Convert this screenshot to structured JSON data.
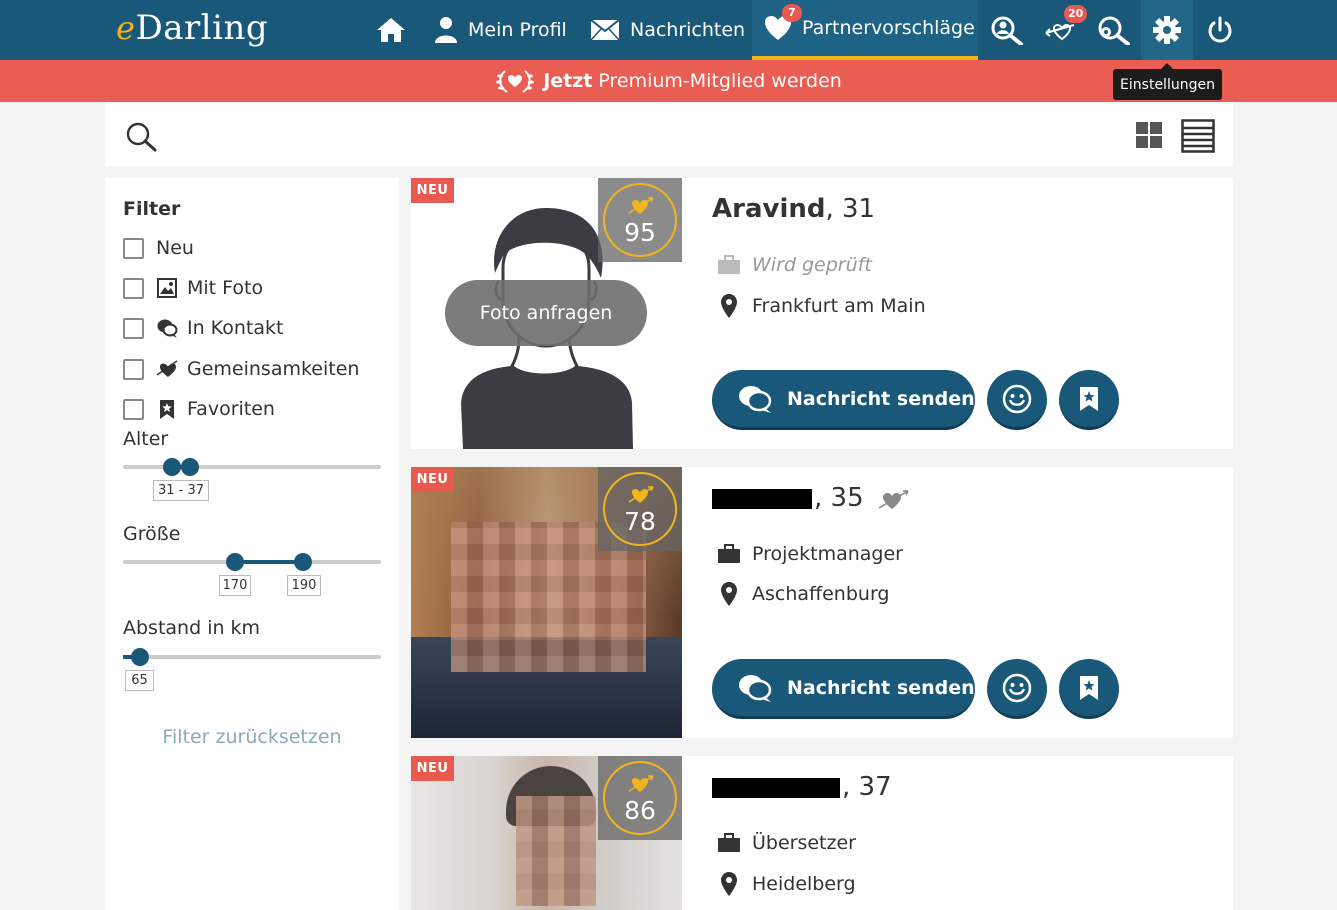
{
  "app": {
    "logo_prefix": "e",
    "logo_main": "Darling"
  },
  "nav": {
    "home_icon": "home-icon",
    "profile_label": "Mein Profil",
    "messages_label": "Nachrichten",
    "matches_label": "Partnervorschläge",
    "matches_badge": "7",
    "visitors_icon": "search-person-icon",
    "smiles_icon": "arrow-heart-icon",
    "smiles_badge": "20",
    "search_icon": "gear-search-icon",
    "settings_icon": "gear-icon",
    "logout_icon": "power-icon",
    "settings_tooltip": "Einstellungen"
  },
  "promo": {
    "bold": "Jetzt",
    "text": "Premium-Mitglied werden"
  },
  "colors": {
    "navy": "#1a5879",
    "coral": "#ea5d52",
    "gold": "#f2b51e"
  },
  "filter": {
    "title": "Filter",
    "options": [
      {
        "label": "Neu"
      },
      {
        "label": "Mit Foto"
      },
      {
        "label": "In Kontakt"
      },
      {
        "label": "Gemeinsamkeiten"
      },
      {
        "label": "Favoriten"
      }
    ],
    "age_label": "Alter",
    "age_value": "31 - 37",
    "height_label": "Größe",
    "height_min": "170",
    "height_max": "190",
    "distance_label": "Abstand in km",
    "distance_value": "65",
    "reset_label": "Filter zurücksetzen"
  },
  "cards": [
    {
      "badge": "NEU",
      "score": "95",
      "name": "Aravind",
      "age": ", 31",
      "job": "Wird geprüft",
      "city": "Frankfurt am Main",
      "photo_request": "Foto anfragen",
      "message_label": "Nachricht senden"
    },
    {
      "badge": "NEU",
      "score": "78",
      "age": ", 35",
      "job": "Projektmanager",
      "city": "Aschaffenburg",
      "message_label": "Nachricht senden"
    },
    {
      "badge": "NEU",
      "score": "86",
      "age": ", 37",
      "job": "Übersetzer",
      "city": "Heidelberg"
    }
  ]
}
